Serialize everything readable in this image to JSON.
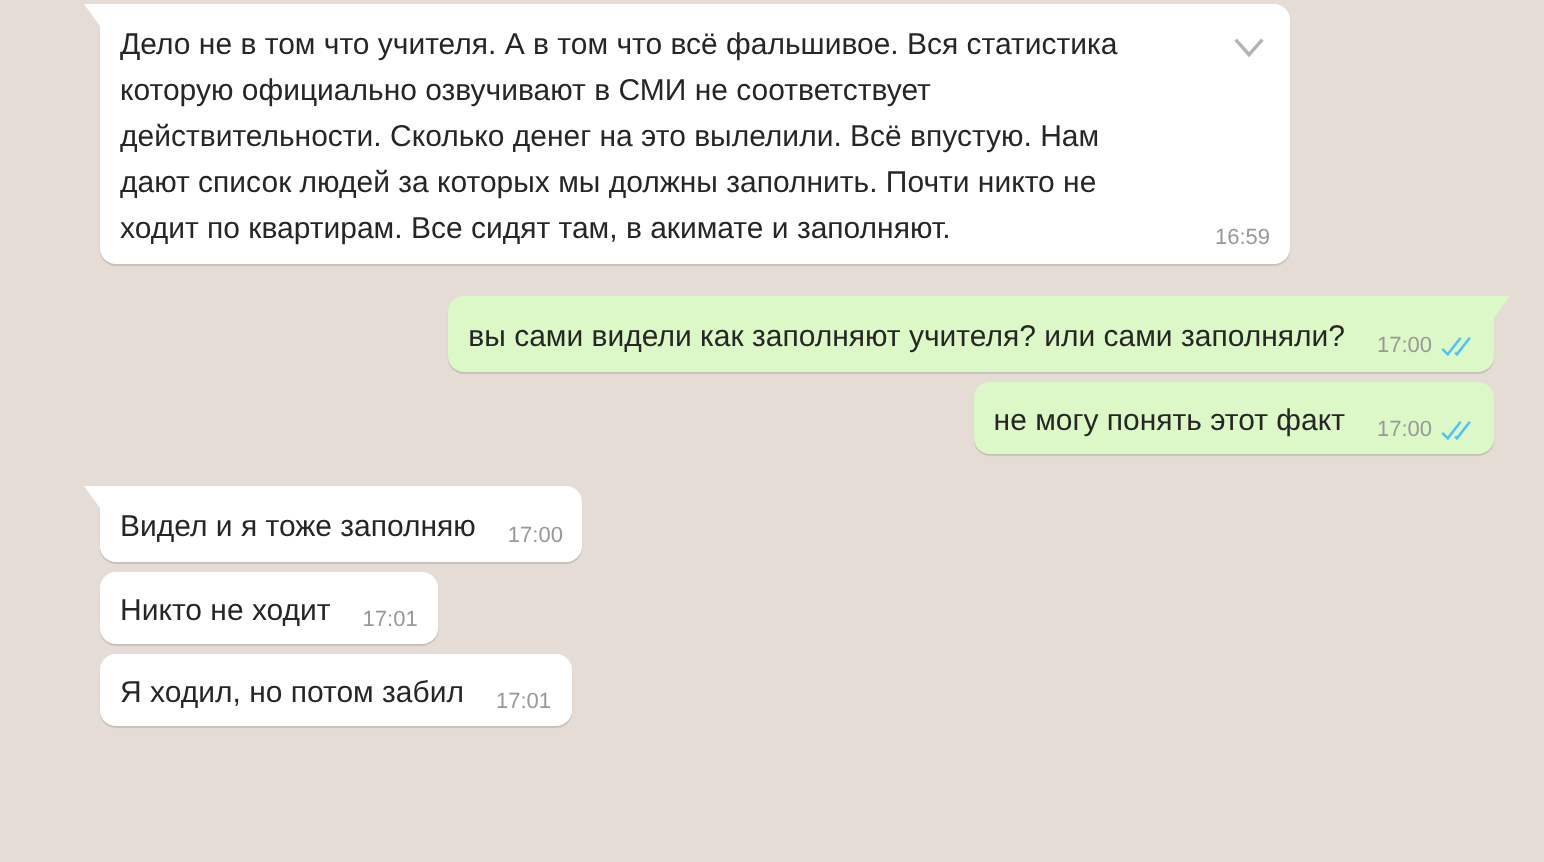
{
  "messages": [
    {
      "outgoing": false,
      "menu_shown": true,
      "text": "Дело не в том что учителя. А в том что всё фальшивое. Вся статистика которую официально озвучивают в СМИ не соответствует действительности. Сколько денег на это вылелили. Всё впустую. Нам дают список людей за которых мы должны заполнить. Почти никто не ходит по квартирам. Все сидят там, в акимате и заполняют.",
      "time": "16:59"
    },
    {
      "outgoing": true,
      "menu_shown": false,
      "text": "вы сами видели как заполняют учителя? или сами заполняли?",
      "time": "17:00",
      "read": true
    },
    {
      "outgoing": true,
      "menu_shown": false,
      "text": "не могу понять этот факт",
      "time": "17:00",
      "read": true
    },
    {
      "outgoing": false,
      "menu_shown": false,
      "text": "Видел и я тоже заполняю",
      "time": "17:00"
    },
    {
      "outgoing": false,
      "menu_shown": false,
      "text": "Никто не ходит",
      "time": "17:01"
    },
    {
      "outgoing": false,
      "menu_shown": false,
      "text": "Я ходил, но потом забил",
      "time": "17:01"
    }
  ]
}
